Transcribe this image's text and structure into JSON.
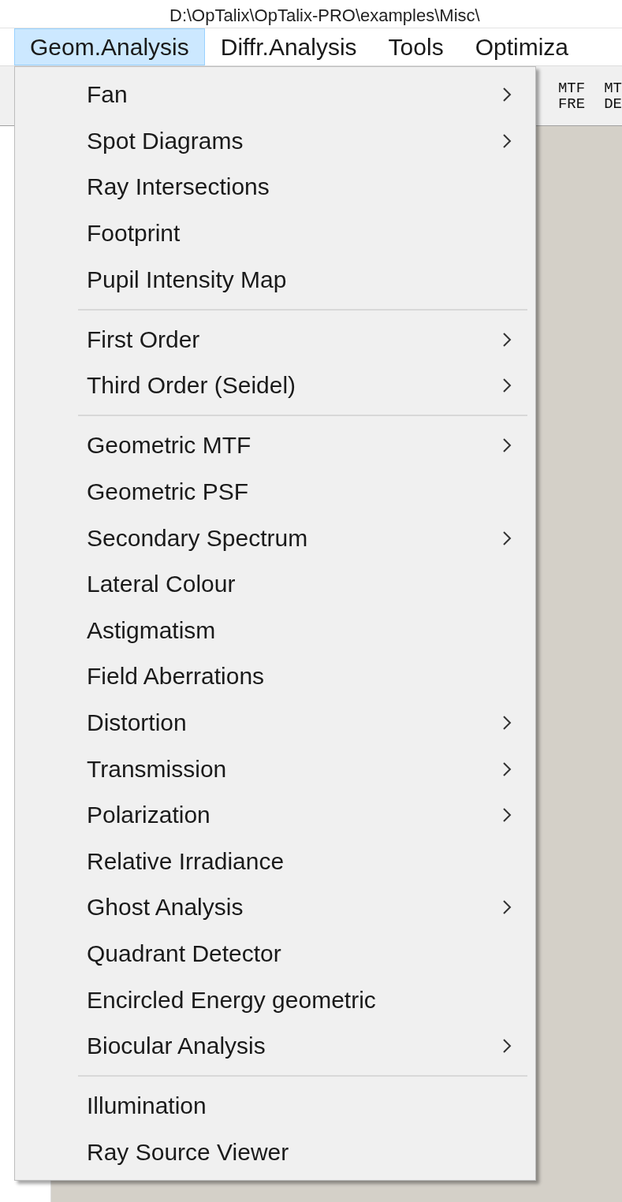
{
  "title": "D:\\OpTalix\\OpTalix-PRO\\examples\\Misc\\",
  "menubar": [
    {
      "label": "Geom.Analysis",
      "selected": true
    },
    {
      "label": "Diffr.Analysis",
      "selected": false
    },
    {
      "label": "Tools",
      "selected": false
    },
    {
      "label": "Optimiza",
      "selected": false
    }
  ],
  "toolbar": [
    {
      "lines": [
        "MTF",
        "FRE"
      ]
    },
    {
      "lines": [
        "MT",
        "DE"
      ]
    }
  ],
  "menu": {
    "sections": [
      {
        "items": [
          {
            "label": "Fan",
            "submenu": true
          },
          {
            "label": "Spot Diagrams",
            "submenu": true
          },
          {
            "label": "Ray Intersections",
            "submenu": false
          },
          {
            "label": "Footprint",
            "submenu": false
          },
          {
            "label": "Pupil Intensity Map",
            "submenu": false
          }
        ]
      },
      {
        "items": [
          {
            "label": "First Order",
            "submenu": true
          },
          {
            "label": "Third Order (Seidel)",
            "submenu": true
          }
        ]
      },
      {
        "items": [
          {
            "label": "Geometric MTF",
            "submenu": true
          },
          {
            "label": "Geometric PSF",
            "submenu": false
          },
          {
            "label": "Secondary Spectrum",
            "submenu": true
          },
          {
            "label": "Lateral Colour",
            "submenu": false
          },
          {
            "label": "Astigmatism",
            "submenu": false
          },
          {
            "label": "Field Aberrations",
            "submenu": false
          },
          {
            "label": "Distortion",
            "submenu": true
          },
          {
            "label": "Transmission",
            "submenu": true
          },
          {
            "label": "Polarization",
            "submenu": true
          },
          {
            "label": "Relative Irradiance",
            "submenu": false
          },
          {
            "label": "Ghost Analysis",
            "submenu": true
          },
          {
            "label": "Quadrant Detector",
            "submenu": false
          },
          {
            "label": "Encircled Energy geometric",
            "submenu": false
          },
          {
            "label": "Biocular Analysis",
            "submenu": true
          }
        ]
      },
      {
        "items": [
          {
            "label": "Illumination",
            "submenu": false
          },
          {
            "label": "Ray Source Viewer",
            "submenu": false
          }
        ]
      }
    ]
  }
}
